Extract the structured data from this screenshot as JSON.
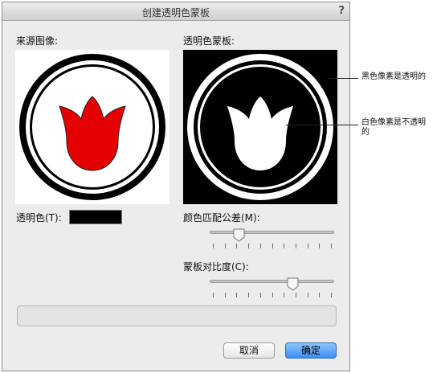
{
  "dialog": {
    "title": "创建透明色蒙板",
    "help": "?"
  },
  "source": {
    "label": "来源图像:",
    "image_icon": "red-tulip-in-black-ring-icon"
  },
  "mask": {
    "label": "透明色蒙板:",
    "image_icon": "white-tulip-on-black-mask-icon"
  },
  "transparent_color": {
    "label": "透明色(T):",
    "value_color": "#000000"
  },
  "tolerance": {
    "label": "颜色匹配公差(M):",
    "value_fraction": 0.22
  },
  "contrast": {
    "label": "蒙板对比度(C):",
    "value_fraction": 0.68
  },
  "buttons": {
    "cancel": "取消",
    "ok": "确定"
  },
  "annotations": {
    "black_pixels": "黑色像素是透明的",
    "white_pixels_line1": "白色像素是不透明",
    "white_pixels_line2": "的"
  },
  "colors": {
    "accent_button": "#3c8ef2",
    "tulip_red": "#e40000"
  }
}
